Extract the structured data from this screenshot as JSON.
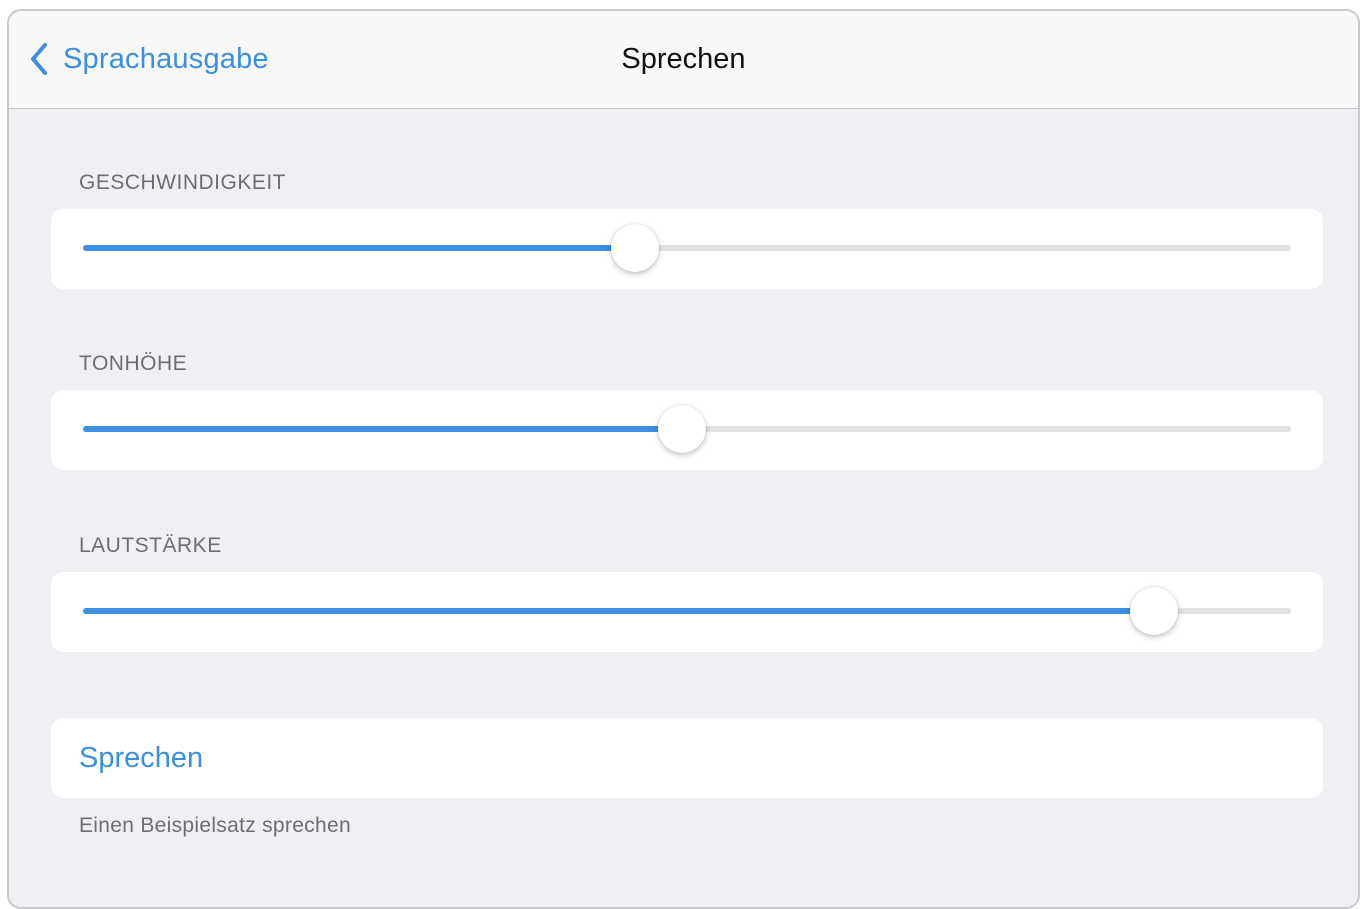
{
  "navbar": {
    "back_label": "Sprachausgabe",
    "title": "Sprechen"
  },
  "sliders": [
    {
      "label": "GESCHWINDIGKEIT",
      "value": 0.457
    },
    {
      "label": "TONHÖHE",
      "value": 0.496
    },
    {
      "label": "LAUTSTÄRKE",
      "value": 0.887
    }
  ],
  "speak_button": {
    "label": "Sprechen",
    "footer": "Einen Beispielsatz sprechen"
  },
  "colors": {
    "accent": "#3b8fe3",
    "background": "#efeff4",
    "track": "#e3e3e6"
  }
}
